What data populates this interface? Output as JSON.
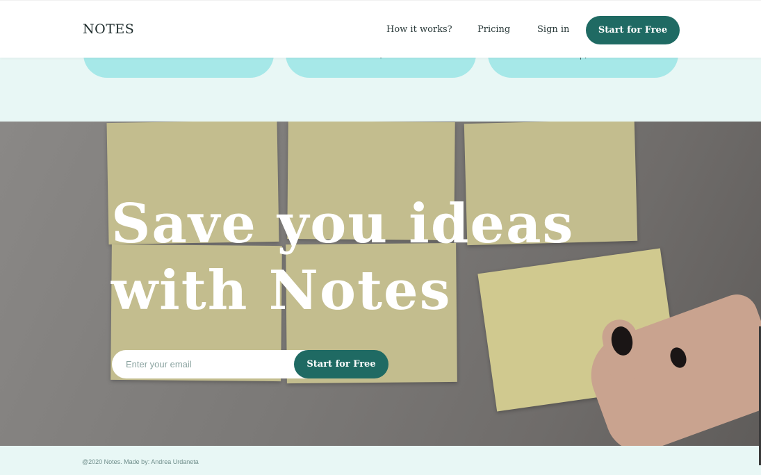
{
  "app": {
    "logo": "NOTES"
  },
  "nav": {
    "links": [
      "How it works?",
      "Pricing",
      "Sign in"
    ],
    "cta_label": "Start for Free"
  },
  "cards": [
    {
      "text": ""
    },
    {
      "text": "."
    },
    {
      "text": ", ."
    }
  ],
  "hero": {
    "title_line1": "Save you ideas",
    "title_line2": "with Notes",
    "email_placeholder": "Enter your email",
    "email_value": "",
    "cta_label": "Start for Free"
  },
  "footer": {
    "text": "@2020 Notes. Made by: Andrea Urdaneta"
  },
  "colors": {
    "brand": "#1f6a63",
    "card_bg": "#a6e8e8",
    "page_bg": "#e8f7f5",
    "sticky_note": "#c3bd8e"
  }
}
